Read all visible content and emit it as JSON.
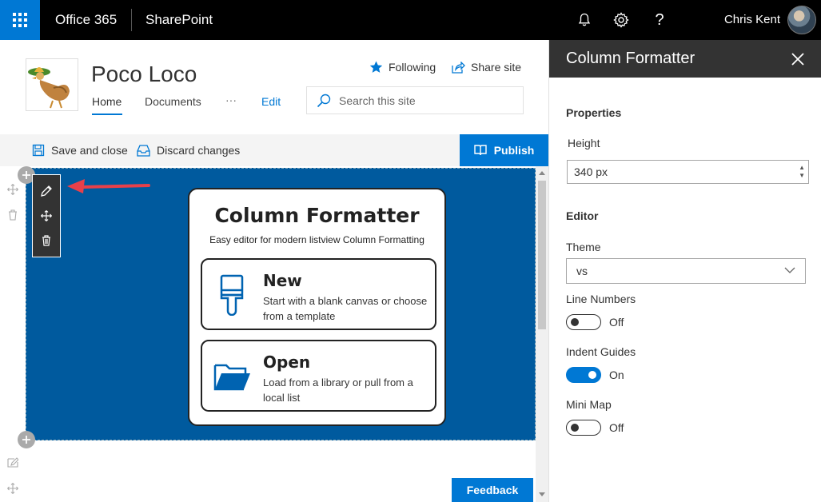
{
  "suitebar": {
    "app_name": "Office 365",
    "site_app": "SharePoint",
    "user_name": "Chris Kent",
    "icons": [
      "waffle-icon",
      "bell-icon",
      "gear-icon",
      "help-icon",
      "avatar"
    ]
  },
  "site": {
    "title": "Poco Loco",
    "nav": [
      {
        "label": "Home",
        "selected": true
      },
      {
        "label": "Documents"
      },
      {
        "label": "···"
      },
      {
        "label": "Edit"
      }
    ],
    "following_label": "Following",
    "share_label": "Share site",
    "search_placeholder": "Search this site"
  },
  "commandbar": {
    "save_close_label": "Save and close",
    "discard_label": "Discard changes",
    "publish_label": "Publish"
  },
  "webpart": {
    "title": "Column Formatter",
    "subtitle": "Easy editor for modern listview Column Formatting",
    "options": [
      {
        "title": "New",
        "description": "Start with a blank canvas or choose from a template",
        "icon": "paintbrush-icon"
      },
      {
        "title": "Open",
        "description": "Load from a library or pull from a local list",
        "icon": "folder-open-icon"
      }
    ]
  },
  "feedback_label": "Feedback",
  "pane": {
    "title": "Column Formatter",
    "properties_group": "Properties",
    "height_label": "Height",
    "height_value": "340 px",
    "editor_group": "Editor",
    "theme_label": "Theme",
    "theme_value": "vs",
    "line_numbers_label": "Line Numbers",
    "line_numbers_state": "Off",
    "indent_guides_label": "Indent Guides",
    "indent_guides_state": "On",
    "minimap_label": "Mini Map",
    "minimap_state": "Off"
  },
  "colors": {
    "accent": "#0078d4",
    "webpart_bg": "#005a9e",
    "suitebar": "#000000",
    "pane_header": "#333333",
    "annotation_arrow": "#e8404a"
  }
}
